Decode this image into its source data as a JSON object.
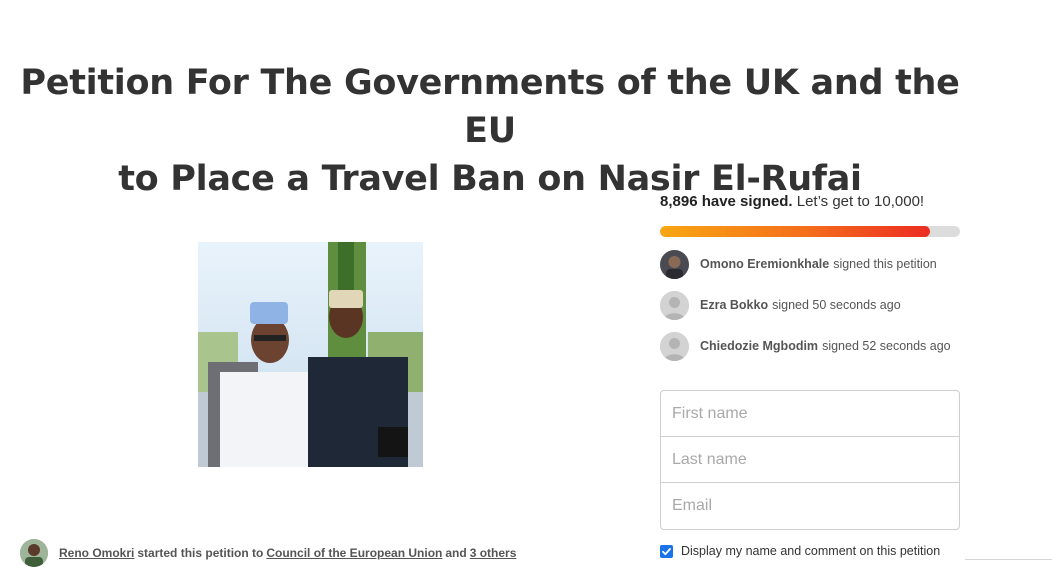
{
  "petition": {
    "title_line1": "Petition For The Governments of the UK and the EU",
    "title_line2": "to Place a Travel Ban on Nasir El-Rufai",
    "image_icon": "petition-photo"
  },
  "starter": {
    "name": "Reno Omokri",
    "middle_text": "started this petition to",
    "recipient": "Council of the European Union",
    "and_text": "and",
    "others": "3 others"
  },
  "progress": {
    "signed_count": "8,896 have signed.",
    "goal_text": "Let’s get to 10,000!",
    "fraction": 0.9,
    "colors": {
      "start": "#f8a614",
      "end": "#ec2c22",
      "track": "#dcdcdc"
    }
  },
  "recent_signers": [
    {
      "name": "Omono Eremionkhale",
      "action": "signed this petition",
      "avatar": "photo-avatar"
    },
    {
      "name": "Ezra Bokko",
      "action": "signed 50 seconds ago",
      "avatar": "default-user-icon"
    },
    {
      "name": "Chiedozie Mgbodim",
      "action": "signed 52 seconds ago",
      "avatar": "default-user-icon"
    }
  ],
  "form": {
    "first_name_placeholder": "First name",
    "last_name_placeholder": "Last name",
    "email_placeholder": "Email"
  },
  "consent": {
    "checked": true,
    "label": "Display my name and comment on this petition",
    "color": "#1a73e8"
  }
}
